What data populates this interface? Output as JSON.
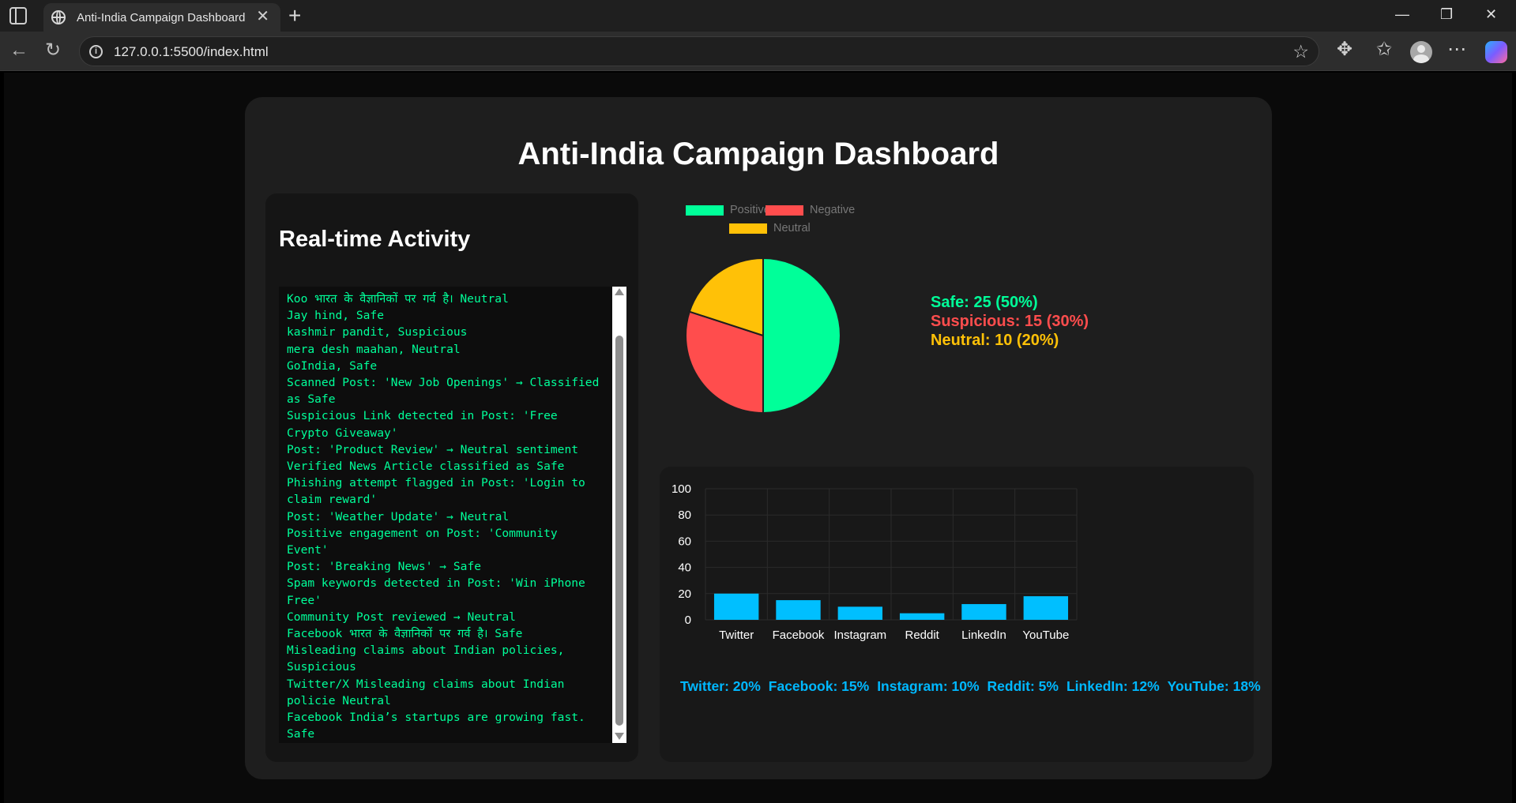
{
  "browser": {
    "tab_title": "Anti-India Campaign Dashboard",
    "url": "127.0.0.1:5500/index.html"
  },
  "dashboard": {
    "title": "Anti-India Campaign Dashboard",
    "activity": {
      "title": "Real-time Activity",
      "logs": [
        "Koo भारत के वैज्ञानिकों पर गर्व है। Neutral",
        "Jay hind, Safe",
        "kashmir pandit, Suspicious",
        "mera desh maahan, Neutral",
        "GoIndia, Safe",
        "Scanned Post: 'New Job Openings' → Classified as Safe",
        "Suspicious Link detected in Post: 'Free Crypto Giveaway'",
        "Post: 'Product Review' → Neutral sentiment",
        "Verified News Article classified as Safe",
        "Phishing attempt flagged in Post: 'Login to claim reward'",
        "Post: 'Weather Update' → Neutral",
        "Positive engagement on Post: 'Community Event'",
        "Post: 'Breaking News' → Safe",
        "Spam keywords detected in Post: 'Win iPhone Free'",
        "Community Post reviewed → Neutral",
        "Facebook भारत के वैज्ञानिकों पर गर्व है। Safe",
        "Misleading claims about Indian policies, Suspicious",
        "Twitter/X Misleading claims about Indian policie Neutral",
        "Facebook India’s startups are growing fast. Safe"
      ]
    },
    "summary": {
      "safe": "Safe: 25 (50%)",
      "suspicious": "Suspicious: 15 (30%)",
      "neutral": "Neutral: 10 (20%)"
    },
    "platform_stats": [
      "Twitter: 20%",
      "Facebook: 15%",
      "Instagram: 10%",
      "Reddit: 5%",
      "LinkedIn: 12%",
      "YouTube: 18%"
    ]
  },
  "colors": {
    "positive": "#00ff99",
    "negative": "#ff4d4d",
    "neutral": "#ffc107",
    "bar": "#00bfff"
  },
  "chart_data": [
    {
      "type": "pie",
      "categories": [
        "Positive",
        "Negative",
        "Neutral"
      ],
      "values": [
        50,
        30,
        20
      ],
      "colors": [
        "#00ff99",
        "#ff4d4d",
        "#ffc107"
      ],
      "legend": "top"
    },
    {
      "type": "bar",
      "categories": [
        "Twitter",
        "Facebook",
        "Instagram",
        "Reddit",
        "LinkedIn",
        "YouTube"
      ],
      "values": [
        20,
        15,
        10,
        5,
        12,
        18
      ],
      "ylim": [
        0,
        100
      ],
      "yticks": [
        0,
        20,
        40,
        60,
        80,
        100
      ],
      "color": "#00bfff",
      "grid": true
    }
  ]
}
